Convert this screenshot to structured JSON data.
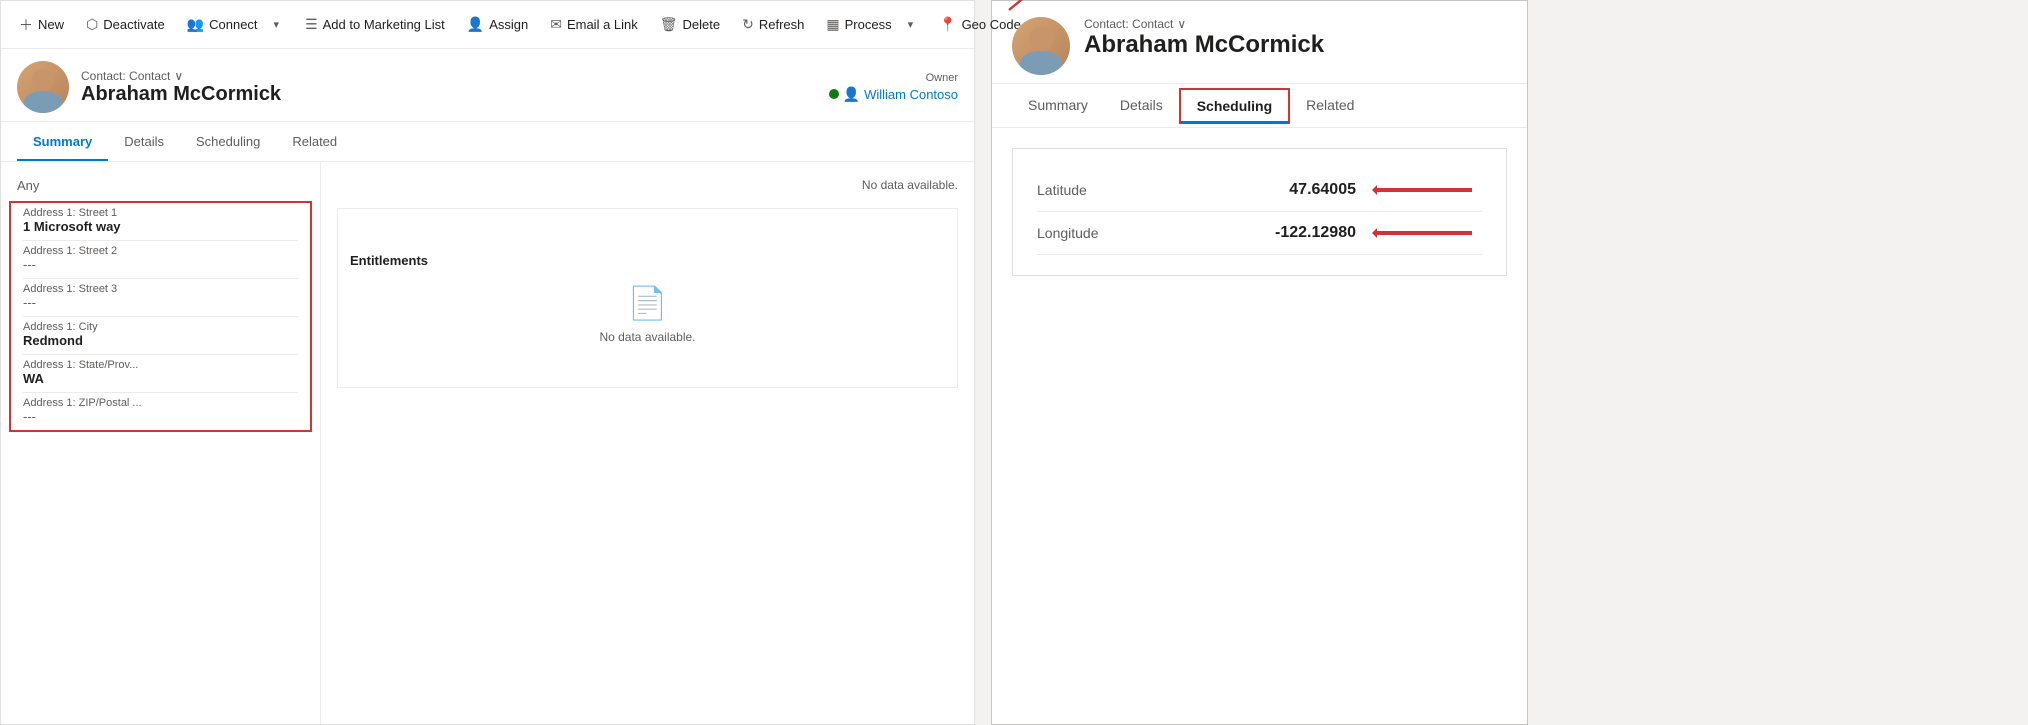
{
  "toolbar": {
    "new_label": "New",
    "deactivate_label": "Deactivate",
    "connect_label": "Connect",
    "add_to_marketing_label": "Add to Marketing List",
    "assign_label": "Assign",
    "email_link_label": "Email a Link",
    "delete_label": "Delete",
    "refresh_label": "Refresh",
    "process_label": "Process",
    "geo_code_label": "Geo Code"
  },
  "record": {
    "entity_type": "Contact: Contact",
    "name": "Abraham McCormick",
    "owner_label": "Owner",
    "owner_name": "William Contoso"
  },
  "tabs_left": {
    "items": [
      {
        "label": "Summary",
        "active": true
      },
      {
        "label": "Details",
        "active": false
      },
      {
        "label": "Scheduling",
        "active": false
      },
      {
        "label": "Related",
        "active": false
      }
    ]
  },
  "address_section": {
    "any_label": "Any",
    "fields": [
      {
        "label": "Address 1: Street 1",
        "value": "1 Microsoft way",
        "empty": false
      },
      {
        "label": "Address 1: Street 2",
        "value": "---",
        "empty": true
      },
      {
        "label": "Address 1: Street 3",
        "value": "---",
        "empty": true
      },
      {
        "label": "Address 1: City",
        "value": "Redmond",
        "empty": false
      },
      {
        "label": "Address 1: State/Prov...",
        "value": "WA",
        "empty": false
      },
      {
        "label": "Address 1: ZIP/Postal ...",
        "value": "---",
        "empty": true
      }
    ]
  },
  "right_column": {
    "no_data": "No data available.",
    "entitlements_label": "Entitlements",
    "entitlements_no_data": "No data available."
  },
  "right_panel": {
    "entity_type": "Contact: Contact",
    "name": "Abraham McCormick",
    "tabs": [
      {
        "label": "Summary",
        "active": false
      },
      {
        "label": "Details",
        "active": false
      },
      {
        "label": "Scheduling",
        "active": true
      },
      {
        "label": "Related",
        "active": false
      }
    ],
    "scheduling": {
      "latitude_label": "Latitude",
      "latitude_value": "47.64005",
      "longitude_label": "Longitude",
      "longitude_value": "-122.12980"
    }
  }
}
